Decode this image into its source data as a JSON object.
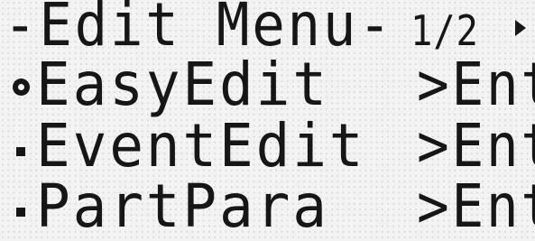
{
  "header": {
    "title": "-Edit Menu-",
    "page_indicator": "1/2",
    "next_page_icon": "right-triangle-icon"
  },
  "menu": {
    "items": [
      {
        "label": "EasyEdit",
        "action": ">Ent",
        "selected": true,
        "bullet_icon": "selected-bullet-icon"
      },
      {
        "label": "EventEdit",
        "action": ">Ent",
        "selected": false,
        "bullet_icon": "bullet-icon"
      },
      {
        "label": "PartPara",
        "action": ">Ent",
        "selected": false,
        "bullet_icon": "bullet-icon"
      }
    ]
  },
  "colors": {
    "lcd_background": "#f3f3f3",
    "lcd_text": "#161616"
  }
}
